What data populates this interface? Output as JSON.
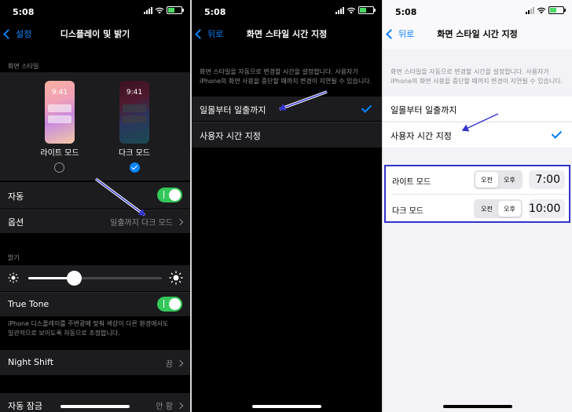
{
  "colors": {
    "accent_dark": "#0a84ff",
    "accent_light": "#007aff",
    "toggle_on": "#34c759",
    "annotation": "#3333cc"
  },
  "panel1": {
    "status_time": "5:08",
    "back_label": "설정",
    "title": "디스플레이 및 밝기",
    "section_style": "화면 스타일",
    "light_mode": {
      "preview_time": "9:41",
      "label": "라이트 모드"
    },
    "dark_mode": {
      "preview_time": "9:41",
      "label": "다크 모드"
    },
    "auto_label": "자동",
    "options_label": "옵션",
    "options_value": "일출까지 다크 모드",
    "section_brightness": "밝기",
    "brightness_level": 0.34,
    "true_tone_label": "True Tone",
    "true_tone_desc_1": "iPhone 디스플레이를 주변광에 맞춰 색상이 다른 환경에서도",
    "true_tone_desc_2": "일관적으로 보이도록 자동으로 조정합니다.",
    "night_shift_label": "Night Shift",
    "night_shift_value": "끔",
    "auto_lock_label": "자동 잠금",
    "auto_lock_value": "안 함"
  },
  "panel2": {
    "status_time": "5:08",
    "back_label": "뒤로",
    "title": "화면 스타일 시간 지정",
    "desc_1": "화면 스타일을 자동으로 변경할 시간을 설정합니다. 사용자가",
    "desc_2": "iPhone의 화면 사용을 중단할 때까지 변경이 지연될 수 있습니다.",
    "option_sunset": "일몰부터 일출까지",
    "option_custom": "사용자 시간 지정"
  },
  "panel3": {
    "status_time": "5:08",
    "back_label": "뒤로",
    "title": "화면 스타일 시간 지정",
    "desc_1": "화면 스타일을 자동으로 변경할 시간을 설정합니다. 사용자가",
    "desc_2": "iPhone의 화면 사용을 중단할 때까지 변경이 지연될 수 있습니다.",
    "option_sunset": "일몰부터 일출까지",
    "option_custom": "사용자 시간 지정",
    "light_row": {
      "label": "라이트 모드",
      "am": "오전",
      "pm": "오후",
      "time": "7:00"
    },
    "dark_row": {
      "label": "다크 모드",
      "am": "오전",
      "pm": "오후",
      "time": "10:00"
    }
  }
}
